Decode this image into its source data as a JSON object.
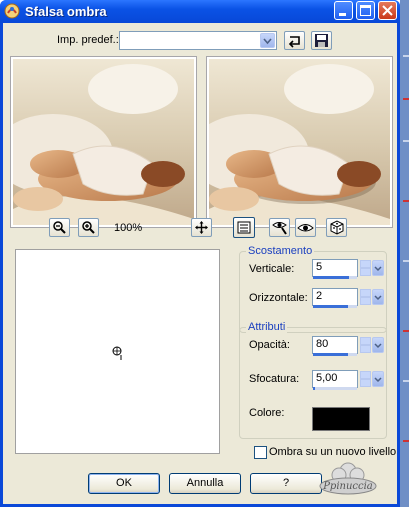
{
  "window": {
    "title": "Sfalsa ombra"
  },
  "preset": {
    "label": "Imp. predef.:",
    "value": ""
  },
  "zoom": {
    "level": "100%"
  },
  "offset_group": {
    "title": "Scostamento",
    "vertical_label": "Verticale:",
    "vertical_value": "5",
    "vertical_fraction": 0.82,
    "horizontal_label": "Orizzontale:",
    "horizontal_value": "2",
    "horizontal_fraction": 0.8
  },
  "attributes_group": {
    "title": "Attributi",
    "opacity_label": "Opacità:",
    "opacity_value": "80",
    "opacity_fraction": 0.8,
    "blur_label": "Sfocatura:",
    "blur_value": "5,00",
    "blur_fraction": 0.05,
    "color_label": "Colore:",
    "color_value": "#000000"
  },
  "shadow_new_layer": {
    "label": "Ombra su un nuovo livello",
    "checked": false
  },
  "buttons": {
    "ok": "OK",
    "cancel": "Annulla",
    "help": "?"
  },
  "watermark": "Ppinuccia",
  "colors": {
    "titlebar": "#0a52e5",
    "client": "#ece9d8",
    "group_title": "#1a3fbf",
    "slider_fill": "#3a6fd8"
  }
}
